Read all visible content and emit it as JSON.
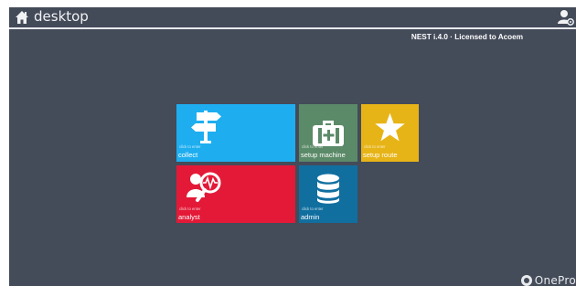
{
  "app": {
    "title": "desktop",
    "license": "NEST i.4.0 · Licensed to Acoem",
    "brand": "OnePro"
  },
  "colors": {
    "background": "#444b59",
    "collect": "#1eaef0",
    "setup_machine": "#5b8a68",
    "setup_route": "#e7b417",
    "analyst": "#e31937",
    "admin": "#116fa0"
  },
  "tiles": {
    "collect": {
      "hint": "click to enter",
      "label": "collect",
      "icon": "signpost-icon"
    },
    "setup_machine": {
      "hint": "click to enter",
      "label": "setup machine",
      "icon": "medical-kit-icon"
    },
    "setup_route": {
      "hint": "click to enter",
      "label": "setup route",
      "icon": "star-icon"
    },
    "analyst": {
      "hint": "click to enter",
      "label": "analyst",
      "icon": "analyst-magnifier-icon"
    },
    "admin": {
      "hint": "click to enter",
      "label": "admin",
      "icon": "database-icon"
    }
  }
}
